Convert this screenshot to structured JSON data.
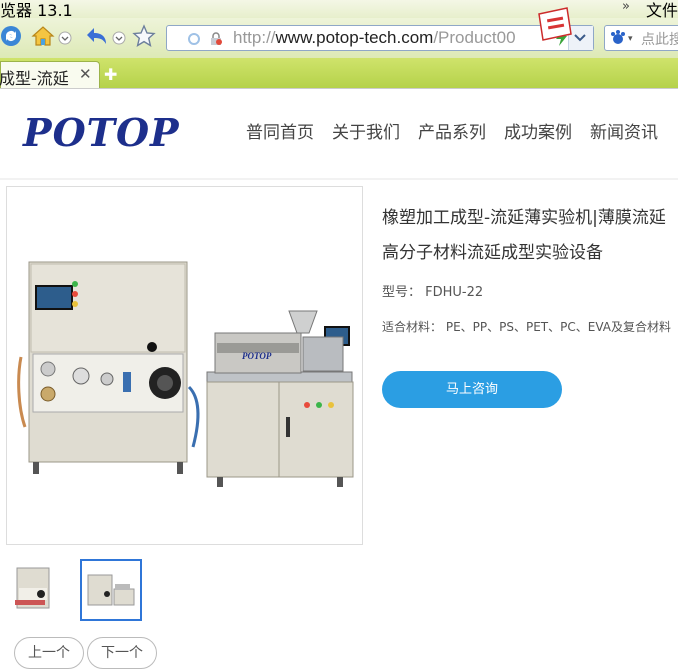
{
  "browser": {
    "window_title": "览器 13.1",
    "file_menu": "文件",
    "url_domain": "www.potop-tech.com",
    "url_prefix": "http://",
    "url_suffix": "/Product00",
    "search_placeholder": "点此搜",
    "tab_title": "成型-流延"
  },
  "site": {
    "logo": "POTOP",
    "nav": [
      "普同首页",
      "关于我们",
      "产品系列",
      "成功案例",
      "新闻资讯"
    ]
  },
  "product": {
    "title_line1": "橡塑加工成型-流延薄实验机|薄膜流延",
    "title_line2": "高分子材料流延成型实验设备",
    "model_label": "型号：",
    "model_value": "FDHU-22",
    "materials_label": "适合材料：",
    "materials_value": "PE、PP、PS、PET、PC、EVA及复合材料",
    "consult_button": "马上咨询",
    "prev_button": "上一个",
    "next_button": "下一个",
    "machine_brand_plate": "POTOP"
  }
}
